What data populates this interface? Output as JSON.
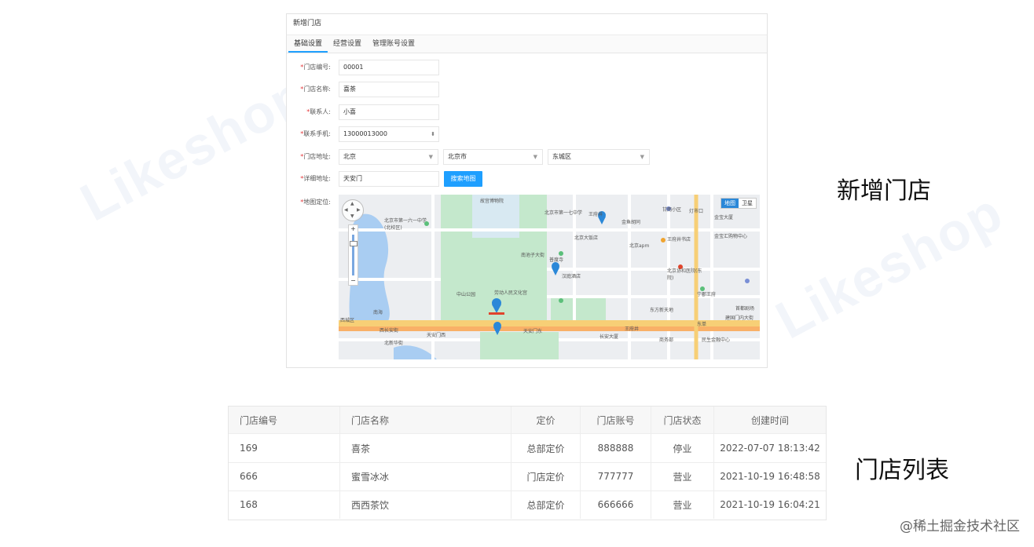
{
  "watermark": {
    "text": "Likeshop"
  },
  "form": {
    "title": "新增门店",
    "tabs": [
      "基础设置",
      "经营设置",
      "管理账号设置"
    ],
    "fields": {
      "code": {
        "label": "门店编号:",
        "value": "00001"
      },
      "name": {
        "label": "门店名称:",
        "value": "喜茶"
      },
      "contact": {
        "label": "联系人:",
        "value": "小喜"
      },
      "phone": {
        "label": "联系手机:",
        "value": "13000013000"
      },
      "region": {
        "label": "门店地址:",
        "province": "北京",
        "city": "北京市",
        "district": "东城区"
      },
      "address": {
        "label": "详细地址:",
        "value": "天安门"
      },
      "map": {
        "label": "地图定位:"
      }
    },
    "search_button": "搜索地图",
    "required_mark": "*"
  },
  "map": {
    "type_buttons": [
      "地图",
      "卫星"
    ],
    "places": [
      "故宫博物院",
      "北京市第一七中学",
      "北京市第一六一中学(北校区)",
      "王府井",
      "金鱼胡同",
      "北京大饭店",
      "北京apm",
      "王府井书店",
      "金宝大厦",
      "金宝汇购物中心",
      "甘雨小区",
      "灯市口",
      "南池子大街",
      "普度寺",
      "汉庭酒店",
      "中山公园",
      "劳动人民文化宫",
      "北京协和医院(东院)",
      "东方新天地",
      "王府井",
      "东单",
      "建国门内大街",
      "西长安街",
      "天安门西",
      "天安门东",
      "长安大厦",
      "商务部",
      "民生金融中心",
      "北新华街",
      "宁郡王府",
      "西城区",
      "南海",
      "首都剧场"
    ],
    "colors": {
      "water": "#a9cdf2",
      "park": "#bfe6c8",
      "road": "#ffffff",
      "main_road": "#f7cf76",
      "pin": "#2b88d8"
    }
  },
  "side_labels": {
    "form": "新增门店",
    "list": "门店列表"
  },
  "table": {
    "headers": [
      "门店编号",
      "门店名称",
      "定价",
      "门店账号",
      "门店状态",
      "创建时间"
    ],
    "rows": [
      [
        "169",
        "喜茶",
        "总部定价",
        "888888",
        "停业",
        "2022-07-07 18:13:42"
      ],
      [
        "666",
        "蜜雪冰冰",
        "门店定价",
        "777777",
        "营业",
        "2021-10-19 16:48:58"
      ],
      [
        "168",
        "西西茶饮",
        "总部定价",
        "666666",
        "营业",
        "2021-10-19 16:04:21"
      ]
    ]
  },
  "credit": "@稀土掘金技术社区"
}
